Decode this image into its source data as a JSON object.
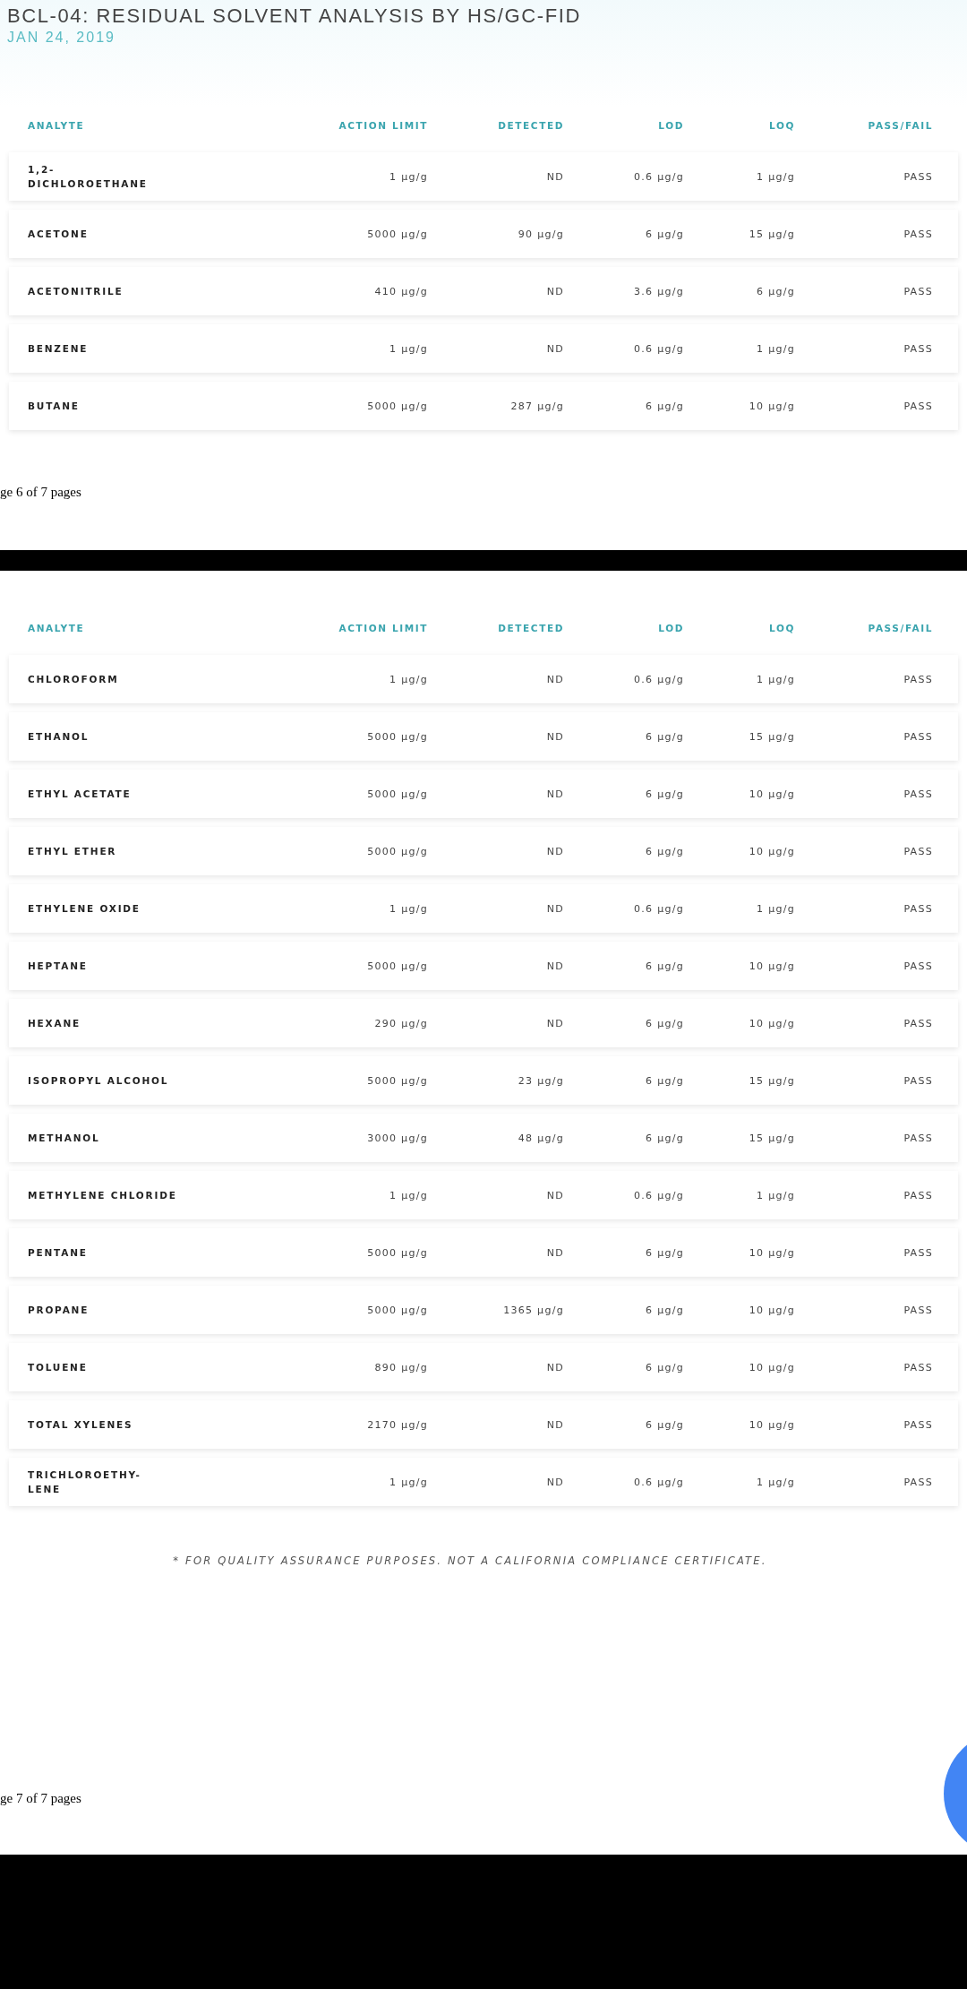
{
  "pages": [
    {
      "title": "BCL-04: RESIDUAL SOLVENT ANALYSIS BY HS/GC-FID",
      "date": "JAN 24, 2019",
      "columns": [
        "ANALYTE",
        "ACTION LIMIT",
        "DETECTED",
        "LOD",
        "LOQ",
        "PASS/FAIL"
      ],
      "rows": [
        {
          "analyte": "1,2-\nDICHLOROETHANE",
          "action_limit": "1 µg/g",
          "detected": "ND",
          "lod": "0.6 µg/g",
          "loq": "1 µg/g",
          "result": "PASS"
        },
        {
          "analyte": "ACETONE",
          "action_limit": "5000 µg/g",
          "detected": "90 µg/g",
          "lod": "6 µg/g",
          "loq": "15 µg/g",
          "result": "PASS"
        },
        {
          "analyte": "ACETONITRILE",
          "action_limit": "410 µg/g",
          "detected": "ND",
          "lod": "3.6 µg/g",
          "loq": "6 µg/g",
          "result": "PASS"
        },
        {
          "analyte": "BENZENE",
          "action_limit": "1 µg/g",
          "detected": "ND",
          "lod": "0.6 µg/g",
          "loq": "1 µg/g",
          "result": "PASS"
        },
        {
          "analyte": "BUTANE",
          "action_limit": "5000 µg/g",
          "detected": "287 µg/g",
          "lod": "6 µg/g",
          "loq": "10 µg/g",
          "result": "PASS"
        }
      ],
      "page_label": "ge 6 of 7 pages"
    },
    {
      "columns": [
        "ANALYTE",
        "ACTION LIMIT",
        "DETECTED",
        "LOD",
        "LOQ",
        "PASS/FAIL"
      ],
      "rows": [
        {
          "analyte": "CHLOROFORM",
          "action_limit": "1 µg/g",
          "detected": "ND",
          "lod": "0.6 µg/g",
          "loq": "1 µg/g",
          "result": "PASS"
        },
        {
          "analyte": "ETHANOL",
          "action_limit": "5000 µg/g",
          "detected": "ND",
          "lod": "6 µg/g",
          "loq": "15 µg/g",
          "result": "PASS"
        },
        {
          "analyte": "ETHYL ACETATE",
          "action_limit": "5000 µg/g",
          "detected": "ND",
          "lod": "6 µg/g",
          "loq": "10 µg/g",
          "result": "PASS"
        },
        {
          "analyte": "ETHYL ETHER",
          "action_limit": "5000 µg/g",
          "detected": "ND",
          "lod": "6 µg/g",
          "loq": "10 µg/g",
          "result": "PASS"
        },
        {
          "analyte": "ETHYLENE OXIDE",
          "action_limit": "1 µg/g",
          "detected": "ND",
          "lod": "0.6 µg/g",
          "loq": "1 µg/g",
          "result": "PASS"
        },
        {
          "analyte": "HEPTANE",
          "action_limit": "5000 µg/g",
          "detected": "ND",
          "lod": "6 µg/g",
          "loq": "10 µg/g",
          "result": "PASS"
        },
        {
          "analyte": "HEXANE",
          "action_limit": "290 µg/g",
          "detected": "ND",
          "lod": "6 µg/g",
          "loq": "10 µg/g",
          "result": "PASS"
        },
        {
          "analyte": "ISOPROPYL ALCOHOL",
          "action_limit": "5000 µg/g",
          "detected": "23 µg/g",
          "lod": "6 µg/g",
          "loq": "15 µg/g",
          "result": "PASS"
        },
        {
          "analyte": "METHANOL",
          "action_limit": "3000 µg/g",
          "detected": "48 µg/g",
          "lod": "6 µg/g",
          "loq": "15 µg/g",
          "result": "PASS"
        },
        {
          "analyte": "METHYLENE CHLORIDE",
          "action_limit": "1 µg/g",
          "detected": "ND",
          "lod": "0.6 µg/g",
          "loq": "1 µg/g",
          "result": "PASS"
        },
        {
          "analyte": "PENTANE",
          "action_limit": "5000 µg/g",
          "detected": "ND",
          "lod": "6 µg/g",
          "loq": "10 µg/g",
          "result": "PASS"
        },
        {
          "analyte": "PROPANE",
          "action_limit": "5000 µg/g",
          "detected": "1365 µg/g",
          "lod": "6 µg/g",
          "loq": "10 µg/g",
          "result": "PASS"
        },
        {
          "analyte": "TOLUENE",
          "action_limit": "890 µg/g",
          "detected": "ND",
          "lod": "6 µg/g",
          "loq": "10 µg/g",
          "result": "PASS"
        },
        {
          "analyte": "TOTAL XYLENES",
          "action_limit": "2170 µg/g",
          "detected": "ND",
          "lod": "6 µg/g",
          "loq": "10 µg/g",
          "result": "PASS"
        },
        {
          "analyte": "TRICHLOROETHY-\nLENE",
          "action_limit": "1 µg/g",
          "detected": "ND",
          "lod": "0.6 µg/g",
          "loq": "1 µg/g",
          "result": "PASS"
        }
      ],
      "footnote": "* FOR QUALITY ASSURANCE PURPOSES. NOT A CALIFORNIA COMPLIANCE CERTIFICATE.",
      "page_label": "ge 7 of 7 pages"
    }
  ]
}
